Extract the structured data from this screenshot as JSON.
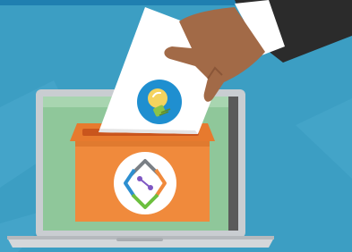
{
  "scene": {
    "description_icons": [
      "lightbulb-icon",
      "tech-logo-icon",
      "ballot-paper",
      "ballot-box",
      "laptop",
      "hand"
    ],
    "colors": {
      "background": "#3c9ec3",
      "top_bar": "#1f7fb0",
      "laptop_frame": "#c9cdd1",
      "laptop_screen": "#8fc79a",
      "ballot_box_front": "#f08a3c",
      "ballot_box_top": "#e77a2e",
      "ballot_slot": "#c9551d",
      "paper": "#ffffff",
      "lightbulb_circle": "#1f8fd0",
      "lightbulb": "#f4d35e",
      "sleeve": "#2b2b2b",
      "skin": "#a26a47"
    }
  }
}
